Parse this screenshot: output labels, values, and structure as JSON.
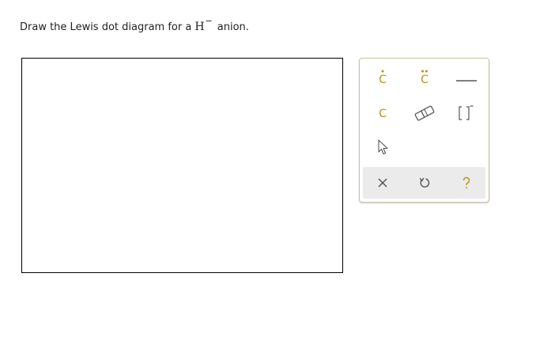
{
  "question": {
    "prefix": "Draw the Lewis dot diagram for a",
    "species": "H",
    "charge": "−",
    "suffix": "anion."
  },
  "palette": {
    "atom_letter": "C",
    "tools": [
      {
        "name": "atom-single-dot",
        "icon": "C with single dot"
      },
      {
        "name": "atom-lone-pair",
        "icon": "C with dot pair"
      },
      {
        "name": "bond-line",
        "icon": "horizontal-line"
      },
      {
        "name": "atom-plain",
        "icon": "C"
      },
      {
        "name": "eraser",
        "icon": "eraser-icon"
      },
      {
        "name": "bracket-charge",
        "icon": "bracket-icon"
      },
      {
        "name": "select-pointer",
        "icon": "cursor-arrow-icon"
      }
    ],
    "actions": [
      {
        "name": "clear",
        "icon": "close-icon"
      },
      {
        "name": "undo",
        "icon": "undo-icon"
      },
      {
        "name": "help",
        "icon": "help-icon"
      }
    ]
  },
  "colors": {
    "atom": "#b5950b",
    "tool_gray": "#555555",
    "action_bar": "#ebebeb",
    "palette_border": "#c9c2a8"
  }
}
